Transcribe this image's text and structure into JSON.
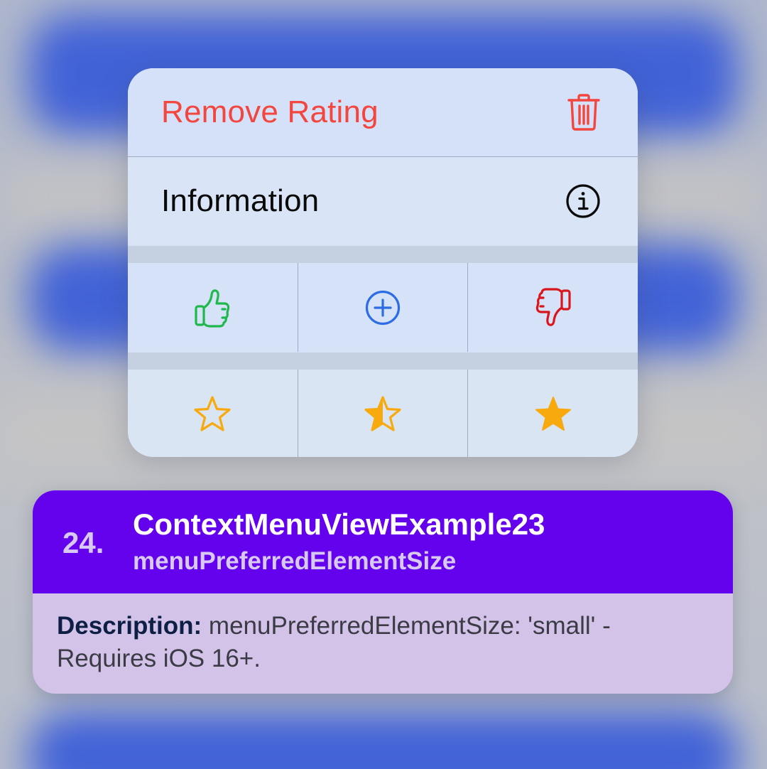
{
  "context_menu": {
    "items": [
      {
        "label": "Remove Rating",
        "icon": "trash-icon",
        "role": "destructive",
        "color": "#f2463f"
      },
      {
        "label": "Information",
        "icon": "info-circle-icon",
        "role": "normal",
        "color": "#0a0a0a"
      }
    ],
    "rating_row": [
      {
        "icon": "thumbs-up-icon",
        "color": "#1fb84d"
      },
      {
        "icon": "plus-circle-icon",
        "color": "#2c6de6"
      },
      {
        "icon": "thumbs-down-icon",
        "color": "#d8161c"
      }
    ],
    "star_row": [
      {
        "icon": "star-outline-icon",
        "color": "#f8a90d"
      },
      {
        "icon": "star-half-icon",
        "color": "#f8a90d"
      },
      {
        "icon": "star-filled-icon",
        "color": "#f8a90d"
      }
    ]
  },
  "card": {
    "number": "24.",
    "title": "ContextMenuViewExample23",
    "subtitle": "menuPreferredElementSize",
    "description_label": "Description:",
    "description_text": " menuPreferredElementSize: 'small' - Requires iOS 16+.",
    "header_color": "#6402ee"
  }
}
